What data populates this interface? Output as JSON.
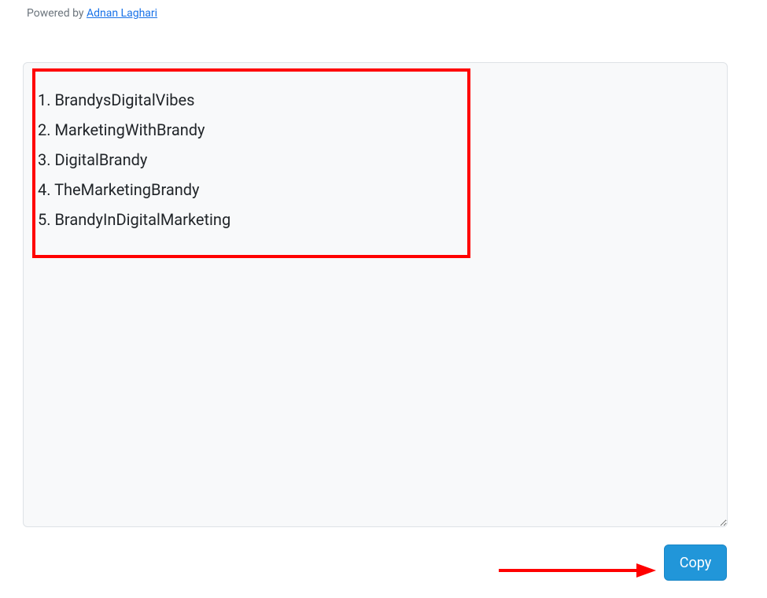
{
  "header": {
    "powered_by_prefix": "Powered by ",
    "powered_by_link": "Adnan Laghari"
  },
  "output": {
    "items": [
      "BrandysDigitalVibes",
      "MarketingWithBrandy",
      "DigitalBrandy",
      "TheMarketingBrandy",
      "BrandyInDigitalMarketing"
    ]
  },
  "actions": {
    "copy_label": "Copy"
  },
  "annotations": {
    "highlight_color": "#ff0000",
    "arrow_color": "#ff0000"
  }
}
